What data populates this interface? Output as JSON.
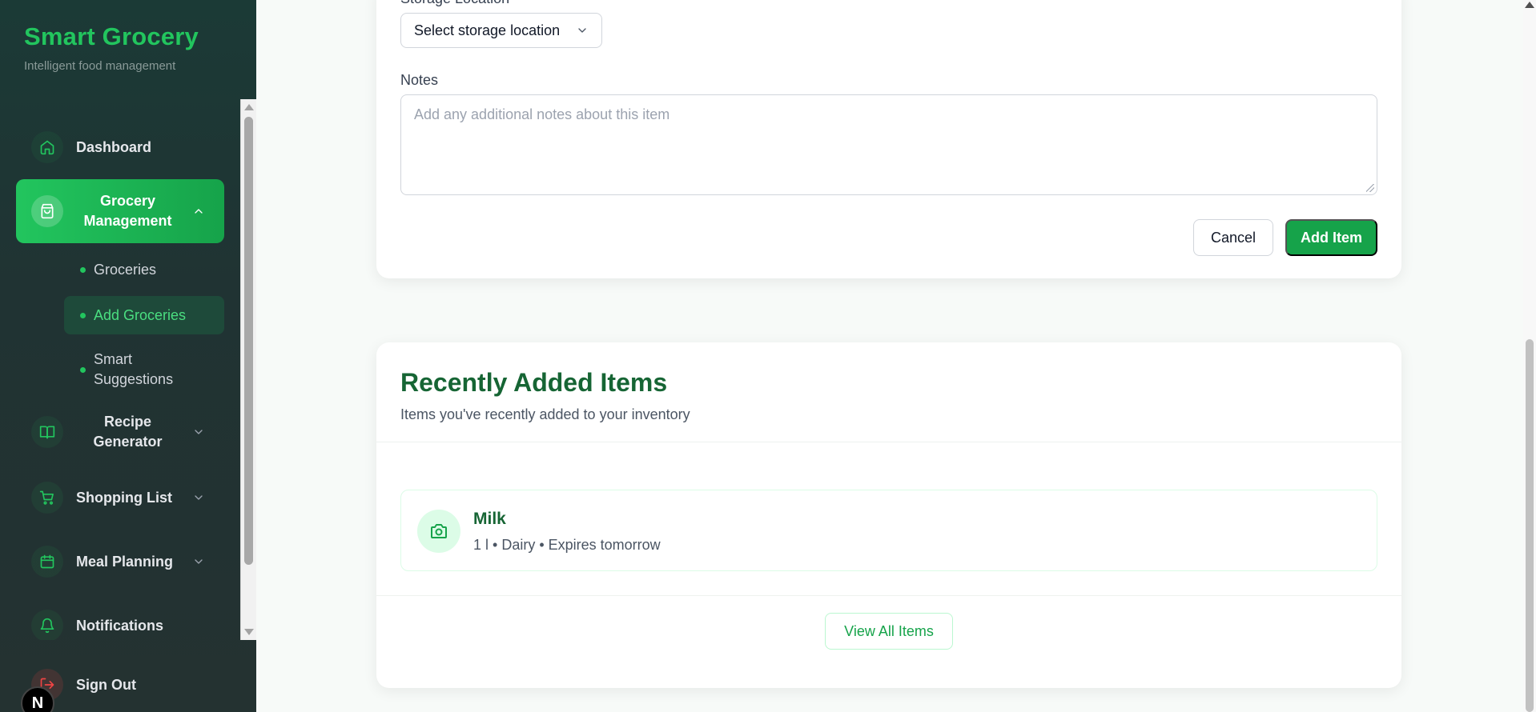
{
  "brand": {
    "title": "Smart Grocery",
    "subtitle": "Intelligent food management"
  },
  "sidebar": {
    "items": [
      {
        "label": "Dashboard",
        "icon": "home-icon"
      },
      {
        "label": "Grocery Management",
        "icon": "shopping-bag-icon",
        "active": true
      },
      {
        "label": "Recipe Generator",
        "icon": "book-icon"
      },
      {
        "label": "Shopping List",
        "icon": "cart-icon"
      },
      {
        "label": "Meal Planning",
        "icon": "calendar-icon"
      },
      {
        "label": "Notifications",
        "icon": "bell-icon"
      }
    ],
    "subitems": [
      {
        "label": "Groceries"
      },
      {
        "label": "Add Groceries",
        "active": true
      },
      {
        "label": "Smart Suggestions"
      }
    ],
    "signout": {
      "label": "Sign Out",
      "icon": "logout-icon"
    },
    "badge": "N"
  },
  "form": {
    "storage_label": "Storage Location",
    "storage_value": "Select storage location",
    "notes_label": "Notes",
    "notes_placeholder": "Add any additional notes about this item",
    "cancel_label": "Cancel",
    "add_label": "Add Item"
  },
  "recent": {
    "title": "Recently Added Items",
    "subtitle": "Items you've recently added to your inventory",
    "items": [
      {
        "name": "Milk",
        "meta": "1 l • Dairy • Expires tomorrow",
        "icon": "camera-icon"
      }
    ],
    "view_all_label": "View All Items"
  },
  "colors": {
    "accent": "#16a34a",
    "sidebar_bg": "#203333",
    "title_green": "#166534"
  }
}
